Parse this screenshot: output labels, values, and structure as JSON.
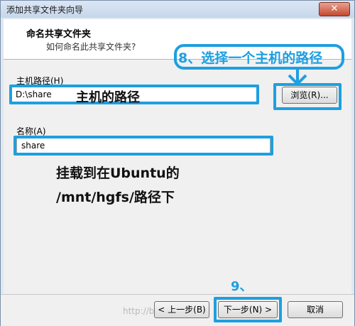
{
  "window": {
    "title": "添加共享文件夹向导",
    "close_glyph": "✕"
  },
  "header": {
    "title": "命名共享文件夹",
    "subtitle": "如何命名此共享文件夹?"
  },
  "host_path": {
    "label": "主机路径(H)",
    "value": "D:\\share",
    "browse_label": "浏览(R)..."
  },
  "name": {
    "label": "名称(A)",
    "value": "share"
  },
  "footer": {
    "back_label": "< 上一步(B)",
    "next_label": "下一步(N) >",
    "cancel_label": "取消"
  },
  "annotations": {
    "step8": "8、选择一个主机的路径",
    "host_path_note": "主机的路径",
    "mount_line1": "挂载到在Ubuntu的",
    "mount_line2": "/mnt/hgfs/路径下",
    "step9": "9、"
  },
  "watermark": "http://blog.csdn.net/",
  "colors": {
    "annotation_blue": "#1e9fe0"
  }
}
